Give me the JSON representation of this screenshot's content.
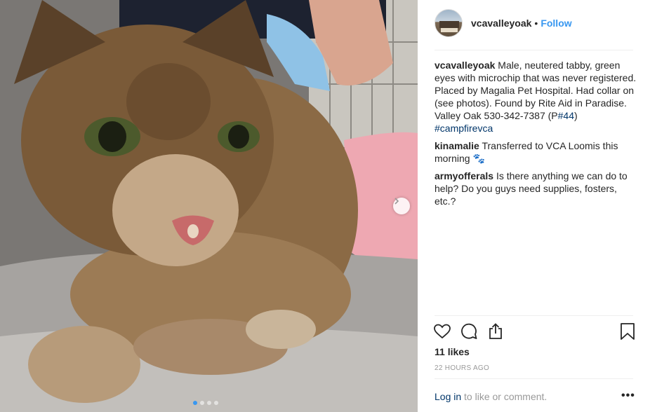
{
  "post": {
    "username": "vcavalleyoak",
    "separator": "•",
    "follow_label": "Follow",
    "image_alt": "Singed tabby cat on a metal exam table",
    "carousel": {
      "slide_count": 4,
      "active_index": 0
    }
  },
  "comments": [
    {
      "user": "vcavalleyoak",
      "text": "Male, neutered tabby, green eyes with microchip that was never registered. Placed by Magalia Pet Hospital. Had collar on (see photos). Found by Rite Aid in Paradise. Valley Oak 530-342-7387 (P",
      "mention": "#44",
      "text_after": ")",
      "hashtag": "#campfirevca"
    },
    {
      "user": "kinamalie",
      "text": "Transferred to VCA Loomis this morning",
      "emoji": "🐾"
    },
    {
      "user": "armyofferals",
      "text": "Is there anything we can do to help? Do you guys need supplies, fosters, etc.?"
    }
  ],
  "actions": {
    "icons": [
      "heart-icon",
      "comment-icon",
      "share-icon",
      "bookmark-icon"
    ]
  },
  "likes_text": "11 likes",
  "timestamp": "22 HOURS AGO",
  "footer": {
    "login_link": "Log in",
    "login_rest": " to like or comment.",
    "more": "•••"
  }
}
